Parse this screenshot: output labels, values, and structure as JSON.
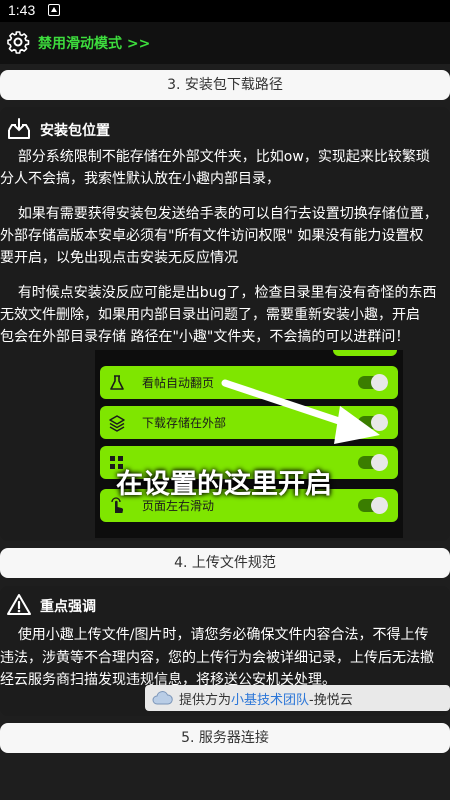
{
  "status_bar": {
    "time": "1:43"
  },
  "header": {
    "title": "禁用滑动模式 >>"
  },
  "sections": {
    "download_path": {
      "label": "3. 安装包下载路径"
    },
    "upload_rules": {
      "label": "4. 上传文件规范"
    },
    "server": {
      "label": "5. 服务器连接"
    }
  },
  "install_location": {
    "title": "安装包位置",
    "para1_line1": "    部分系统限制不能存储在外部文件夹，比如ow，实现起来比较繁琐",
    "para1_line2": "分人不会搞，我索性默认放在小趣内部目录，",
    "para2_line1": "    如果有需要获得安装包发送给手表的可以自行去设置切换存储位置，",
    "para2_line2": "外部存储高版本安卓必须有\"所有文件访问权限\" 如果没有能力设置权",
    "para2_line3": "要开启，以免出现点击安装无反应情况",
    "para3_line1": "    有时候点安装没反应可能是出bug了，检查目录里有没有奇怪的东西",
    "para3_line2": "无效文件删除，如果用内部目录出问题了，需要重新安装小趣，开启",
    "para3_line3": "包会在外部目录存储 路径在\"小趣\"文件夹，不会搞的可以进群问！",
    "embedded_settings": {
      "rows": [
        {
          "label": "看帖自动翻页",
          "icon": "flask-icon"
        },
        {
          "label": "下载存储在外部",
          "icon": "layers-icon"
        },
        {
          "label": "",
          "icon": "grid-icon"
        },
        {
          "label": "页面左右滑动",
          "icon": "hand-icon"
        }
      ],
      "caption": "在设置的这里开启"
    }
  },
  "important": {
    "title": "重点强调",
    "line1": "    使用小趣上传文件/图片时，请您务必确保文件内容合法，不得上传",
    "line2": "违法，涉黄等不合理内容，您的上传行为会被详细记录，上传后无法撤",
    "line3": "经云服务商扫描发现违规信息，将移送公安机关处理。"
  },
  "provider": {
    "prefix": "提供方为",
    "link": "小基技术团队",
    "suffix": "-挽悦云"
  },
  "colors": {
    "accent_green": "#3ddc3d",
    "lime": "#7fe600",
    "link_blue": "#2b76d8"
  }
}
